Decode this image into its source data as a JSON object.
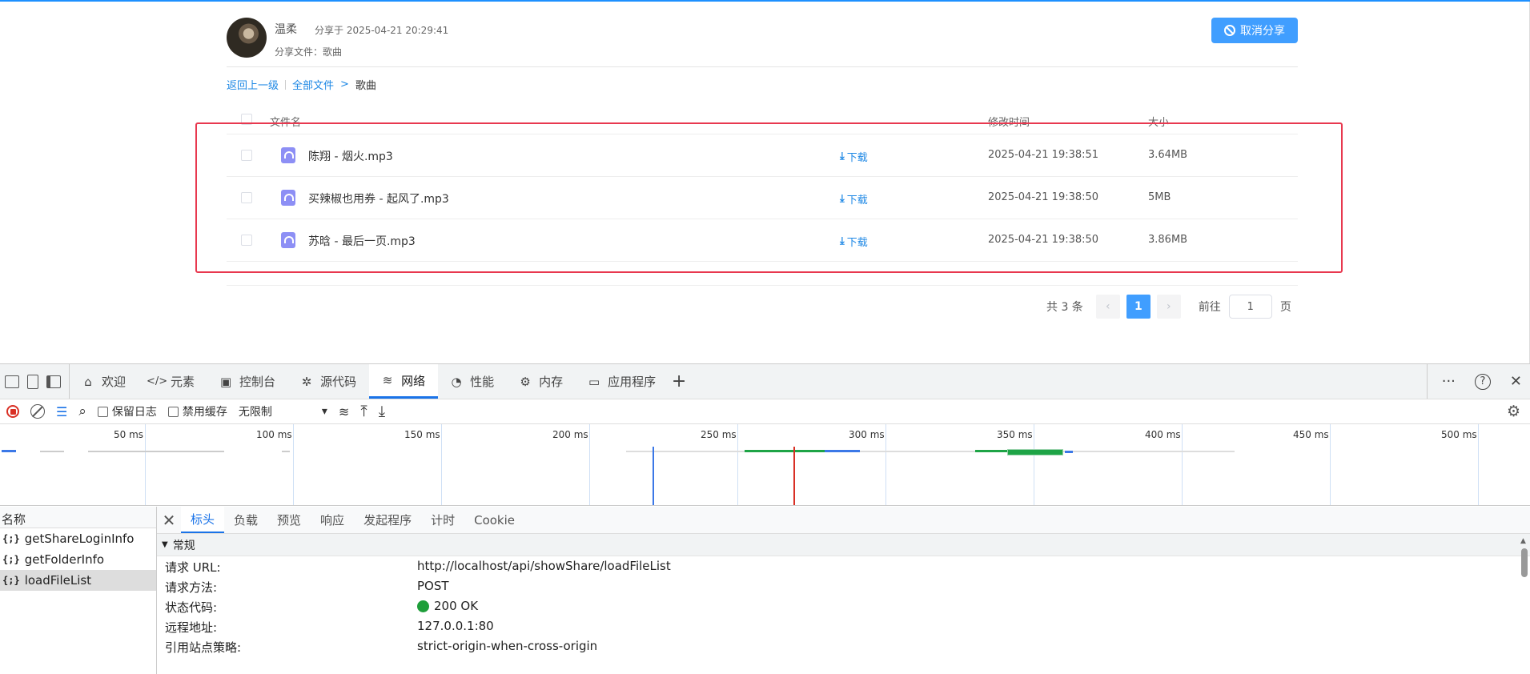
{
  "share": {
    "user_name": "温柔",
    "share_time": "分享于 2025-04-21 20:29:41",
    "share_file": "分享文件：歌曲",
    "cancel_label": "取消分享"
  },
  "breadcrumb": {
    "back": "返回上一级",
    "all_files": "全部文件",
    "chevron": ">",
    "current": "歌曲"
  },
  "table": {
    "headers": {
      "name": "文件名",
      "mtime": "修改时间",
      "size": "大小"
    },
    "download_label": "下载",
    "rows": [
      {
        "name": "陈翔 - 烟火.mp3",
        "mtime": "2025-04-21 19:38:51",
        "size": "3.64MB"
      },
      {
        "name": "买辣椒也用券 - 起风了.mp3",
        "mtime": "2025-04-21 19:38:50",
        "size": "5MB"
      },
      {
        "name": "苏晗 - 最后一页.mp3",
        "mtime": "2025-04-21 19:38:50",
        "size": "3.86MB"
      }
    ]
  },
  "pager": {
    "total": "共 3 条",
    "prev": "‹",
    "current": "1",
    "next": "›",
    "goto": "前往",
    "goto_value": "1",
    "page_unit": "页"
  },
  "devtools": {
    "tabs": [
      {
        "label": "欢迎",
        "icon": "⌂"
      },
      {
        "label": "元素",
        "icon": "</>"
      },
      {
        "label": "控制台",
        "icon": "▣"
      },
      {
        "label": "源代码",
        "icon": "✲"
      },
      {
        "label": "网络",
        "icon": "≋"
      },
      {
        "label": "性能",
        "icon": "◔"
      },
      {
        "label": "内存",
        "icon": "⚙"
      },
      {
        "label": "应用程序",
        "icon": "▭"
      }
    ],
    "add_tab": "+",
    "more": "···",
    "help": "?",
    "close": "✕",
    "toolbar": {
      "preserve_log": "保留日志",
      "disable_cache": "禁用缓存",
      "throttle": "无限制",
      "throttle_arrow": "▾",
      "search_icon": "⌕",
      "upload_icon": "⤒",
      "download_icon": "⤓",
      "wifi_icon": "≋",
      "settings_icon": "⚙"
    },
    "timeline": {
      "ticks": [
        "50 ms",
        "100 ms",
        "150 ms",
        "200 ms",
        "250 ms",
        "300 ms",
        "350 ms",
        "400 ms",
        "450 ms",
        "500 ms"
      ]
    },
    "requests": {
      "header": "名称",
      "items": [
        "getShareLoginInfo",
        "getFolderInfo",
        "loadFileList"
      ],
      "icon": "{;}"
    },
    "detail": {
      "close": "✕",
      "tabs": [
        "标头",
        "负载",
        "预览",
        "响应",
        "发起程序",
        "计时",
        "Cookie"
      ],
      "section": "常规",
      "section_arrow": "▼",
      "rows": [
        {
          "key": "请求 URL:",
          "value": "http://localhost/api/showShare/loadFileList"
        },
        {
          "key": "请求方法:",
          "value": "POST"
        },
        {
          "key": "状态代码:",
          "value": "200 OK"
        },
        {
          "key": "远程地址:",
          "value": "127.0.0.1:80"
        },
        {
          "key": "引用站点策略:",
          "value": "strict-origin-when-cross-origin"
        }
      ]
    }
  },
  "colors": {
    "accent": "#409eff",
    "highlight_box": "#e8384f",
    "status_ok": "#1e9e3a"
  }
}
